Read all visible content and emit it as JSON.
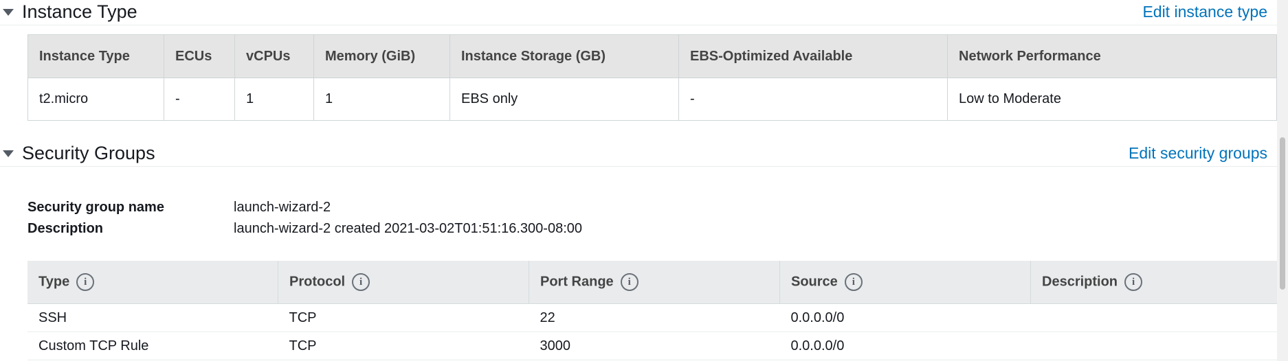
{
  "instance_type_section": {
    "title": "Instance Type",
    "edit_label": "Edit instance type",
    "columns": [
      "Instance Type",
      "ECUs",
      "vCPUs",
      "Memory (GiB)",
      "Instance Storage (GB)",
      "EBS-Optimized Available",
      "Network Performance"
    ],
    "row": [
      "t2.micro",
      "-",
      "1",
      "1",
      "EBS only",
      "-",
      "Low to Moderate"
    ]
  },
  "security_groups_section": {
    "title": "Security Groups",
    "edit_label": "Edit security groups",
    "name_label": "Security group name",
    "name_value": "launch-wizard-2",
    "description_label": "Description",
    "description_value": "launch-wizard-2 created 2021-03-02T01:51:16.300-08:00",
    "columns": [
      "Type",
      "Protocol",
      "Port Range",
      "Source",
      "Description"
    ],
    "info_icon_glyph": "i",
    "rows": [
      [
        "SSH",
        "TCP",
        "22",
        "0.0.0.0/0",
        ""
      ],
      [
        "Custom TCP Rule",
        "TCP",
        "3000",
        "0.0.0.0/0",
        ""
      ]
    ]
  },
  "colors": {
    "link": "#0073bb",
    "header_bg": "#e5e5e5",
    "text": "#16191f"
  }
}
